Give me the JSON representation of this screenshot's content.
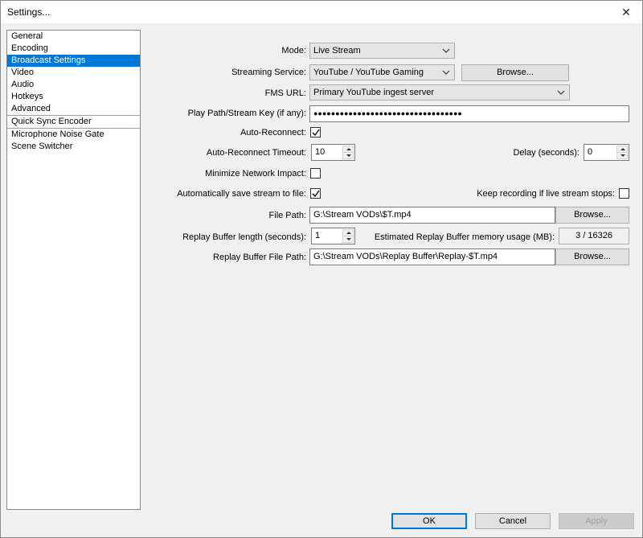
{
  "window": {
    "title": "Settings..."
  },
  "sidebar": {
    "items": [
      "General",
      "Encoding",
      "Broadcast Settings",
      "Video",
      "Audio",
      "Hotkeys",
      "Advanced"
    ],
    "plugins": [
      "Quick Sync Encoder",
      "Microphone Noise Gate",
      "Scene Switcher"
    ],
    "selected": "Broadcast Settings"
  },
  "form": {
    "mode_label": "Mode:",
    "mode_value": "Live Stream",
    "service_label": "Streaming Service:",
    "service_value": "YouTube / YouTube Gaming",
    "service_browse": "Browse...",
    "fms_label": "FMS URL:",
    "fms_value": "Primary YouTube ingest server",
    "key_label": "Play Path/Stream Key (if any):",
    "key_value": "●●●●●●●●●●●●●●●●●●●●●●●●●●●●●●●●●●",
    "autoreconnect_label": "Auto-Reconnect:",
    "autoreconnect_checked": true,
    "timeout_label": "Auto-Reconnect Timeout:",
    "timeout_value": "10",
    "delay_label": "Delay (seconds):",
    "delay_value": "0",
    "minimize_label": "Minimize Network Impact:",
    "minimize_checked": false,
    "autosave_label": "Automatically save stream to file:",
    "autosave_checked": true,
    "keeprec_label": "Keep recording if live stream stops:",
    "keeprec_checked": false,
    "filepath_label": "File Path:",
    "filepath_value": "G:\\Stream VODs\\$T.mp4",
    "filepath_browse": "Browse...",
    "replay_len_label": "Replay Buffer length (seconds):",
    "replay_len_value": "1",
    "replay_mem_label": "Estimated Replay Buffer memory usage (MB):",
    "replay_mem_value": "3 / 16326",
    "replay_path_label": "Replay Buffer File Path:",
    "replay_path_value": "G:\\Stream VODs\\Replay Buffer\\Replay-$T.mp4",
    "replay_path_browse": "Browse..."
  },
  "footer": {
    "ok": "OK",
    "cancel": "Cancel",
    "apply": "Apply"
  },
  "icons": {
    "close": "close-icon",
    "dropdown": "chevron-down-icon",
    "check": "checkmark-icon"
  },
  "colors": {
    "selection": "#0078d7"
  }
}
